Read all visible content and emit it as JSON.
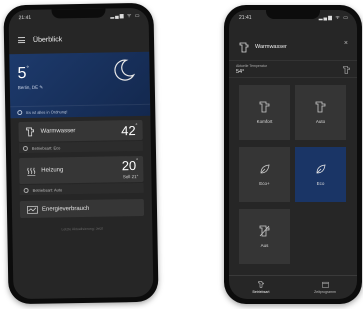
{
  "left": {
    "status": {
      "time": "21:41",
      "icons": "▂▄▆ ᯤ ▭"
    },
    "header": {
      "title": "Überblick"
    },
    "weather": {
      "temp": "5",
      "unit": "°",
      "city": "Berlin, DE",
      "status": "Es ist alles in Ordnung!"
    },
    "cards": [
      {
        "name": "Warmwasser",
        "value": "42",
        "unit": "°",
        "sub": "Betriebsart: Eco"
      },
      {
        "name": "Heizung",
        "value": "20",
        "unit": "°",
        "soll": "Soll 21°",
        "sub": "Betriebsart: Auto"
      },
      {
        "name": "Energieverbrauch"
      }
    ],
    "footer": "Letzte Aktualisierung: Jetzt"
  },
  "right": {
    "status": {
      "time": "21:41",
      "icons": "▂▄▆ ᯤ ▭"
    },
    "header": {
      "title": "Warmwasser",
      "close": "×"
    },
    "current": {
      "label": "Aktuelle Temperatur",
      "value": "54°"
    },
    "modes": [
      {
        "label": "Komfort",
        "icon": "tap-icon",
        "active": false
      },
      {
        "label": "Auto",
        "icon": "tap-icon",
        "active": false
      },
      {
        "label": "Eco+",
        "icon": "leaf-icon",
        "active": false
      },
      {
        "label": "Eco",
        "icon": "leaf-icon",
        "active": true
      },
      {
        "label": "Aus",
        "icon": "tap-off-icon",
        "active": false
      }
    ],
    "tabs": [
      {
        "label": "Betriebsart",
        "selected": true
      },
      {
        "label": "Zeitprogramm",
        "selected": false
      }
    ]
  },
  "colors": {
    "accent": "#1a3566",
    "weather_bg": "#1d3a6c",
    "screen_bg": "#262626",
    "card_bg": "#363636"
  }
}
